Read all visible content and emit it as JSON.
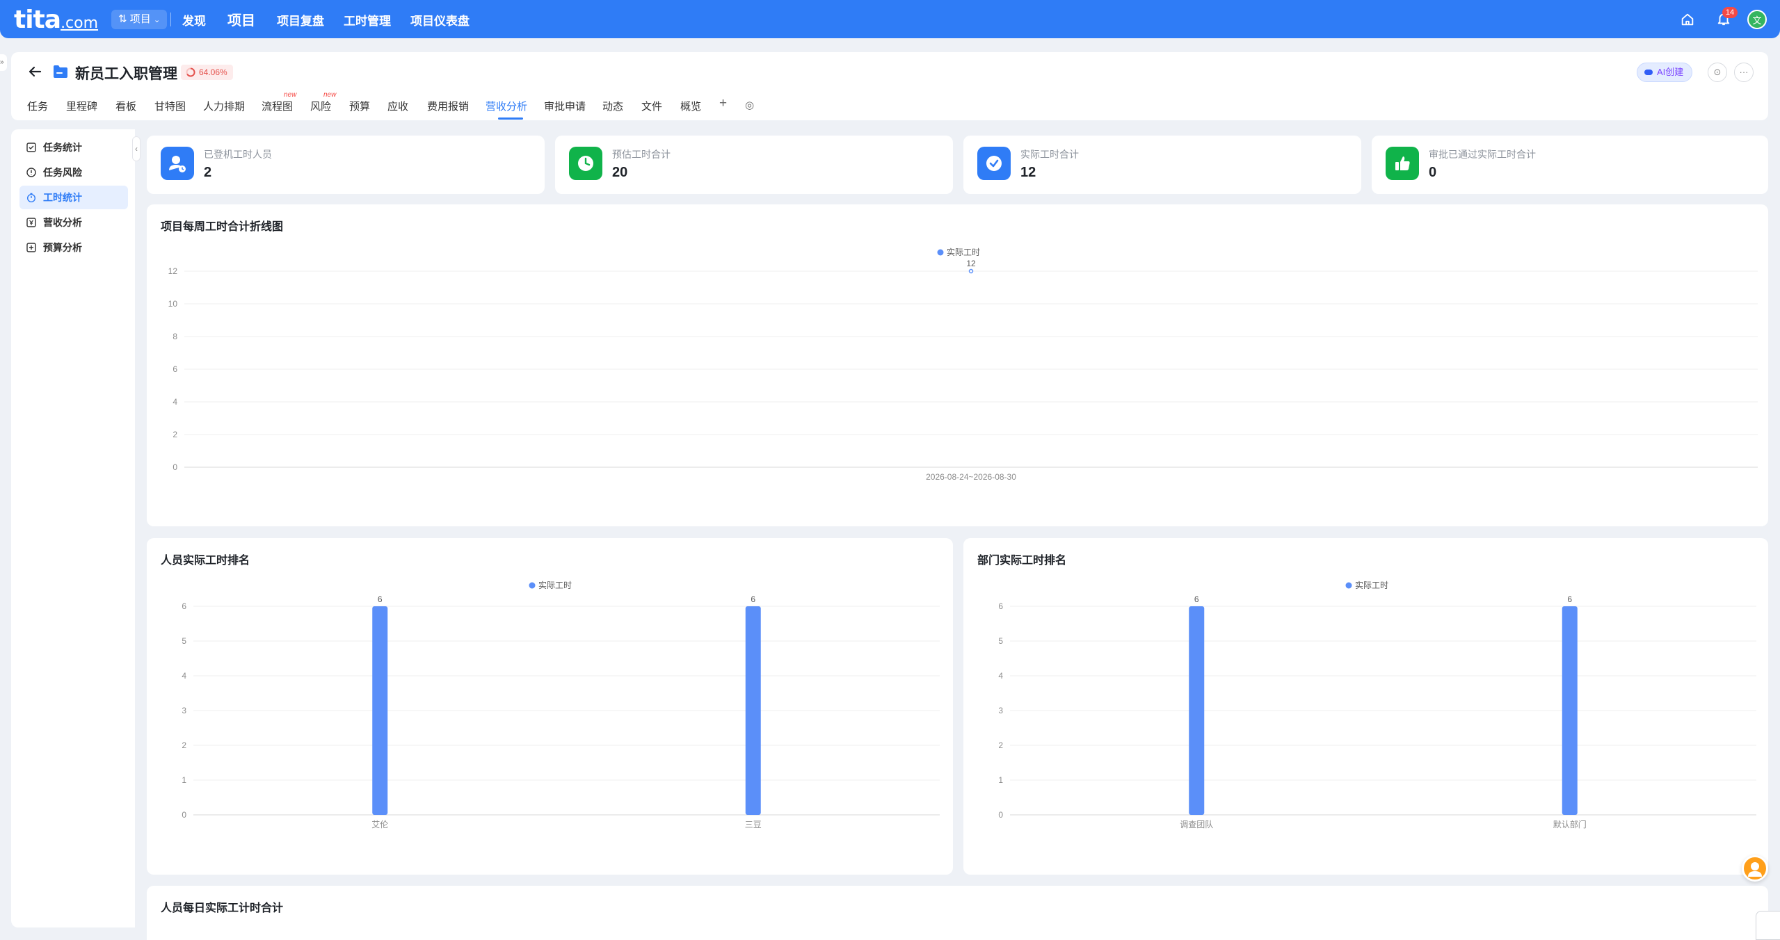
{
  "topbar": {
    "logo_main": "tita",
    "logo_suffix": ".com",
    "project_switch": "项目",
    "nav": [
      "发现",
      "项目",
      "项目复盘",
      "工时管理",
      "项目仪表盘"
    ],
    "notification_count": "14",
    "avatar_text": "文",
    "brand_color": "#2f7cf6"
  },
  "header": {
    "title": "新员工入职管理",
    "progress": "64.06%",
    "ai_button": "AI创建",
    "settings_symbol": "⊙",
    "more_symbol": "···",
    "tabs": [
      "任务",
      "里程碑",
      "看板",
      "甘特图",
      "人力排期",
      "流程图",
      "风险",
      "预算",
      "应收",
      "费用报销",
      "营收分析",
      "审批申请",
      "动态",
      "文件",
      "概览"
    ],
    "active_tab": "营收分析",
    "new_tag": "new",
    "add_symbol": "+",
    "tab_settings_symbol": "◎"
  },
  "sidebar": {
    "items": [
      "任务统计",
      "任务风险",
      "工时统计",
      "营收分析",
      "预算分析"
    ],
    "active": "工时统计"
  },
  "stats": [
    {
      "label": "已登机工时人员",
      "value": "2",
      "icon": "user-clock-icon",
      "color": "#2f7cf6"
    },
    {
      "label": "预估工时合计",
      "value": "20",
      "icon": "clock-icon",
      "color": "#10b34a"
    },
    {
      "label": "实际工时合计",
      "value": "12",
      "icon": "check-circle-icon",
      "color": "#2f7cf6"
    },
    {
      "label": "审批已通过实际工时合计",
      "value": "0",
      "icon": "thumbs-up-icon",
      "color": "#10b34a"
    }
  ],
  "chart_data": [
    {
      "type": "line",
      "title": "项目每周工时合计折线图",
      "legend": "实际工时",
      "categories": [
        "2026-08-24~2026-08-30"
      ],
      "values": [
        12
      ],
      "y_ticks": [
        0,
        2,
        4,
        6,
        8,
        10,
        12
      ],
      "ylim": [
        0,
        12
      ],
      "color": "#5b8ff9"
    },
    {
      "type": "bar",
      "title": "人员实际工时排名",
      "legend": "实际工时",
      "categories": [
        "艾伦",
        "三豆"
      ],
      "values": [
        6,
        6
      ],
      "y_ticks": [
        0,
        1,
        2,
        3,
        4,
        5,
        6
      ],
      "ylim": [
        0,
        6
      ],
      "color": "#5b8ff9"
    },
    {
      "type": "bar",
      "title": "部门实际工时排名",
      "legend": "实际工时",
      "categories": [
        "调查团队",
        "默认部门"
      ],
      "values": [
        6,
        6
      ],
      "y_ticks": [
        0,
        1,
        2,
        3,
        4,
        5,
        6
      ],
      "ylim": [
        0,
        6
      ],
      "color": "#5b8ff9"
    }
  ],
  "bottom_card": {
    "title": "人员每日实际工计时合计"
  }
}
